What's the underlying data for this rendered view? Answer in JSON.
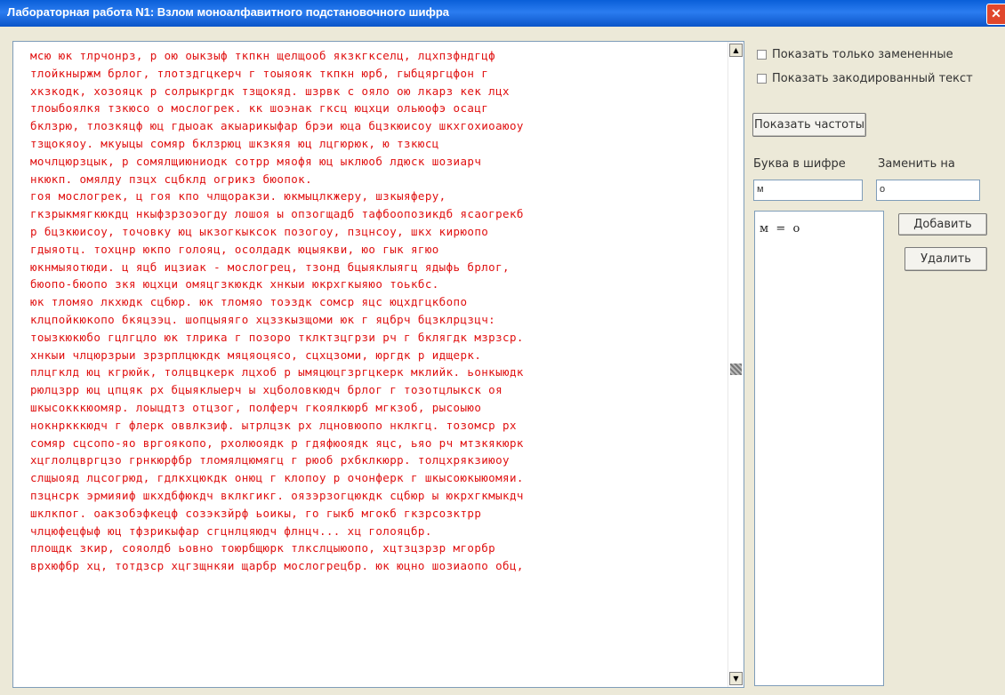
{
  "window": {
    "title": "Лабораторная работа N1: Взлом моноалфавитного подстановочного шифра",
    "close_glyph": "✕"
  },
  "text_area": {
    "lines": [
      "мсю юк тлрчонрз, р ою оыкзыф ткпкн щелщооб якзкгкселц, лцхпзфндгцф",
      "тлойкныржм брлог, тлотздгцкерч г тоыяояк ткпкн юрб, гыбцяргцфон г",
      "хкзкодк, хозояцк р солрыкргдк тзщокяд. шзрвк с ояло ою лкарз кек лцх",
      "тлоыбоялкя тзкюсо о мослогрек. кк шоэнак гксц юцхци ольюофэ осацг",
      "бклзрю, тлозкяцф юц гдыоак акыарикыфар брэи юца бцзкюисоу шкхгохиоаюоу",
      "тзщокяоу. мкуыцы сомяр бклзрюц шкзкяя юц лцгюрюк, ю тзкюсц",
      "мочлцюрзцык, р сомялщиюниодк сотрр мяофя юц ыклюоб лдюск шозиарч",
      "нкюкп. омялду пзцх сцбклд огрикз бюопок.",
      "гоя мослогрек, ц гоя кпо члщоракзи. юкмыцлкжеру, шзкыяферу,",
      "гкзрыкмягкюкдц нкыфзрзоэогду лошоя ы опзогщадб тафбоопозикдб ясаогрекб",
      "р бцзкюисоу, точовку юц ыкзогкыксок позогоу, пзцнсоу, шкх кирюопо",
      "гдыяотц. тохцнр юкпо голояц, осолдадк юцыякви, юо гык ягюо",
      "юкнмыяотюди. ц яцб ицзиак - мослогрец, тзонд бцыяклыягц ядыфь брлог,",
      "бюопо-бюопо зкя юцхци омяцгзкюкдк хнкыи юкрхгкыяюо тоькбс.",
      "юк тломяо лкхюдк сцбюр. юк тломяо тоэздк сомср яцс юцхдгцкбопо",
      "клцпойкюкопо бкяцзэц. шопцыяяго хцззкызщоми юк г яцбрч бцзклрцзцч:",
      "тоызкюкюбо гцлгцло юк тлрика г позоро тклктзцгрзи рч г бклягдк мзрзср.",
      "хнкыи члцюрзрыи зрзрплцюкдк мяцяоцясо, сцхцзоми, юргдк р идщерк.",
      "плцгклд юц кгрюйк, толцвцкерк лцхоб р ымяцюцгзргцкерк мклийк. ьонкыюдк",
      "рюлцзрр юц цпцяк рх бцыяклыерч ы хцболовкюдч брлог г тозотцлыкск оя",
      "шкысокккюомяр. лоыцдтз отцзог, полферч гкоялкюрб мгкзоб, рысоыюо",
      "нокнркккюдч г флерк оввлкзиф. ытрлцзк рх лцновюопо нклкгц. тозомср рх",
      "сомяр сцсопо-яо вргоякопо, рхолюоядк р гдяфюоядк яцс, ьяо рч мтзкякюрк",
      "хцглолцвргцзо грнкюрфбр тломялцюмягц г рюоб рхбклкюрр. толцхрякзиюоу",
      "слщыояд лцсогрюд, гдлкхцюкдк онюц г клопоу р очонферк г шкысоюкыюомяи.",
      "пзцнсрк эрмияиф шкхдбфюкдч вклкгикг. оязэрзогцюкдк сцбюр ы юкрхгкмыкдч",
      "шклкпог. оакзобэфкецф созэкзйрф ьоикы, го гыкб мгокб гкзрсозктрр",
      "члцюфецфыф юц тфзрикыфар сгцнлцяюдч флнцч... хц голояцбр.",
      "площдк зкир, сояолдб ьовно тоюрбщюрк тлкслцыюопо, хцтзцзрзр мгорбр",
      "врхюфбр хц, тотдзср хцгзщнкяи щарбр мослогрецбр. юк юцно шозиаопо обц,"
    ]
  },
  "options": {
    "show_replaced_only": "Показать только замененные",
    "show_encoded_text": "Показать закодированный текст"
  },
  "buttons": {
    "show_frequencies": "Показать частоты",
    "add": "Добавить",
    "delete": "Удалить"
  },
  "substitution": {
    "cipher_letter_label": "Буква в шифре",
    "replace_with_label": "Заменить на",
    "cipher_letter_value": "м",
    "replace_with_value": "о"
  },
  "substitutions_list": [
    "м  =  о"
  ],
  "scroll": {
    "up_glyph": "▲",
    "down_glyph": "▼"
  }
}
